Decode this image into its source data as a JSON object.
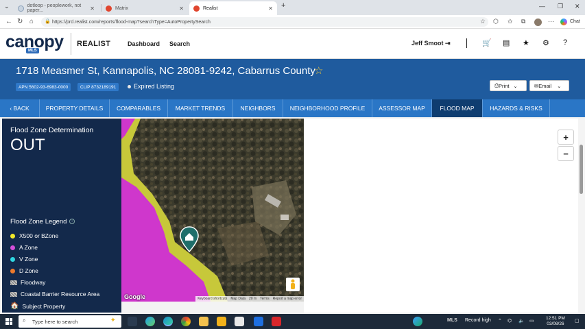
{
  "browser": {
    "tabs": [
      {
        "title": "dotloop - peoplework, not paper...",
        "active": false
      },
      {
        "title": "Matrix",
        "active": false
      },
      {
        "title": "Realist",
        "active": true
      }
    ],
    "url": "https://prd.realist.com/reports/flood-map?searchType=AutoPropertySearch",
    "chat_label": "Chat"
  },
  "header": {
    "logo_text": "canopy",
    "logo_sub": "MLS",
    "product": "REALIST",
    "nav": [
      "Dashboard",
      "Search"
    ],
    "user_name": "Jeff Smoot"
  },
  "property": {
    "address": "1718 Measmer St, Kannapolis, NC 28081-9242, Cabarrus County",
    "apn": "APN 5602-93-6983-0000",
    "clip": "CLIP 8732189191",
    "status": "Expired Listing",
    "print_label": "Print",
    "email_label": "Email"
  },
  "tabs": [
    {
      "label": "BACK",
      "active": false
    },
    {
      "label": "PROPERTY DETAILS",
      "active": false
    },
    {
      "label": "COMPARABLES",
      "active": false
    },
    {
      "label": "MARKET TRENDS",
      "active": false
    },
    {
      "label": "NEIGHBORS",
      "active": false
    },
    {
      "label": "NEIGHBORHOOD PROFILE",
      "active": false
    },
    {
      "label": "ASSESSOR MAP",
      "active": false
    },
    {
      "label": "FLOOD MAP",
      "active": true
    },
    {
      "label": "HAZARDS & RISKS",
      "active": false
    }
  ],
  "flood": {
    "title": "Flood Zone Determination",
    "value": "OUT",
    "legend_title": "Flood Zone Legend",
    "legend": [
      {
        "label": "X500 or BZone",
        "color": "#f2ea2a",
        "kind": "dot"
      },
      {
        "label": "A Zone",
        "color": "#d34fd9",
        "kind": "dot"
      },
      {
        "label": "V Zone",
        "color": "#2fd6e0",
        "kind": "dot"
      },
      {
        "label": "D Zone",
        "color": "#ec7a2c",
        "kind": "dot"
      },
      {
        "label": "Floodway",
        "kind": "hatch"
      },
      {
        "label": "Coastal Barrier Resource Area",
        "kind": "hatch"
      },
      {
        "label": "Subject Property",
        "kind": "home"
      }
    ]
  },
  "map": {
    "attribution": "Google",
    "footer": [
      "Keyboard shortcuts",
      "Map Data",
      "20 m",
      "Terms",
      "Report a map error"
    ],
    "zoom_in": "+",
    "zoom_out": "−"
  },
  "taskbar": {
    "search_placeholder": "Type here to search",
    "tray_text": "Record high",
    "time": "12:51 PM",
    "date": "03/08/26"
  }
}
